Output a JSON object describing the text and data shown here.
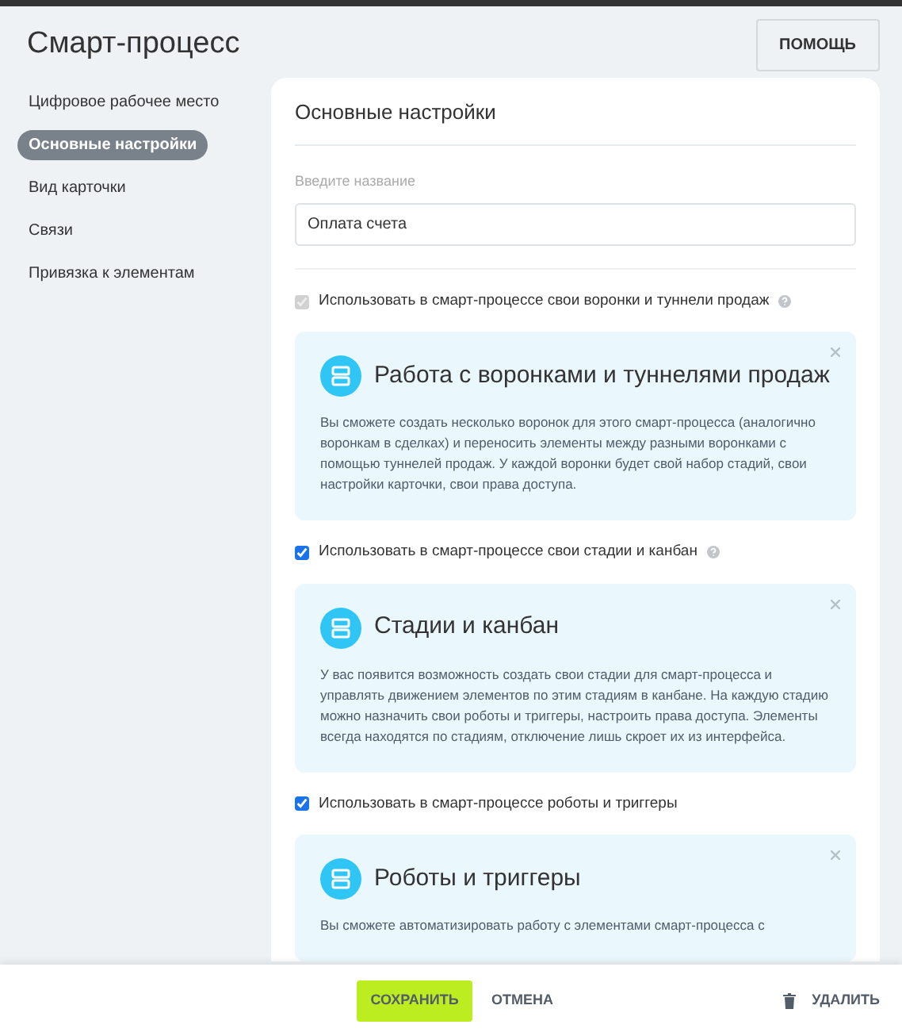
{
  "header": {
    "title": "Смарт-процесс",
    "help_button": "ПОМОЩЬ"
  },
  "sidebar": {
    "items": [
      {
        "label": "Цифровое рабочее место",
        "selected": false
      },
      {
        "label": "Основные настройки",
        "selected": true
      },
      {
        "label": "Вид карточки",
        "selected": false
      },
      {
        "label": "Связи",
        "selected": false
      },
      {
        "label": "Привязка к элементам",
        "selected": false
      }
    ]
  },
  "card": {
    "title": "Основные настройки",
    "name_field": {
      "label": "Введите название",
      "value": "Оплата счета"
    },
    "options": [
      {
        "label": "Использовать в смарт-процессе свои воронки и туннели продаж",
        "checked": true,
        "disabled": true,
        "help": true,
        "info": {
          "title": "Работа с воронками и туннелями продаж",
          "text": "Вы сможете создать несколько воронок для этого смарт-процесса (аналогично воронкам в сделках) и переносить элементы между разными воронками с помощью туннелей продаж. У каждой воронки будет свой набор стадий, свои настройки карточки, свои права доступа."
        }
      },
      {
        "label": "Использовать в смарт-процессе свои стадии и канбан",
        "checked": true,
        "disabled": false,
        "help": true,
        "info": {
          "title": "Стадии и канбан",
          "text": "У вас появится возможность создать свои стадии для смарт-процесса и управлять движением элементов по этим стадиям в канбане. На каждую стадию можно назначить свои роботы и триггеры, настроить права доступа. Элементы всегда находятся по стадиям, отключение лишь скроет их из интерфейса."
        }
      },
      {
        "label": "Использовать в смарт-процессе роботы и триггеры",
        "checked": true,
        "disabled": false,
        "help": false,
        "info": {
          "title": "Роботы и триггеры",
          "text": "Вы сможете автоматизировать работу с элементами смарт-процесса с"
        }
      }
    ]
  },
  "footer": {
    "save": "СОХРАНИТЬ",
    "cancel": "ОТМЕНА",
    "delete": "УДАЛИТЬ"
  }
}
